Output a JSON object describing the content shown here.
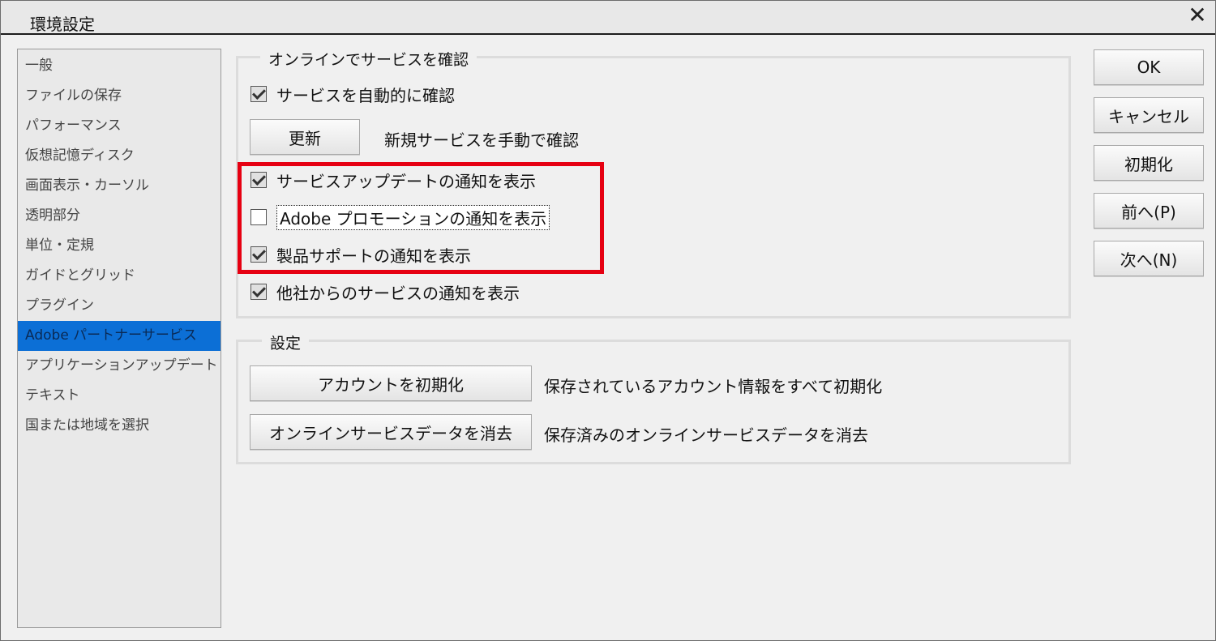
{
  "window": {
    "title": "環境設定"
  },
  "sidebar": {
    "items": [
      {
        "label": "一般"
      },
      {
        "label": "ファイルの保存"
      },
      {
        "label": "パフォーマンス"
      },
      {
        "label": "仮想記憶ディスク"
      },
      {
        "label": "画面表示・カーソル"
      },
      {
        "label": "透明部分"
      },
      {
        "label": "単位・定規"
      },
      {
        "label": "ガイドとグリッド"
      },
      {
        "label": "プラグイン"
      },
      {
        "label": "Adobe パートナーサービス",
        "selected": true
      },
      {
        "label": "アプリケーションアップデート"
      },
      {
        "label": "テキスト"
      },
      {
        "label": "国または地域を選択"
      }
    ]
  },
  "online_group": {
    "legend": "オンラインでサービスを確認",
    "auto_check": {
      "label": "サービスを自動的に確認",
      "checked": true
    },
    "update_button": "更新",
    "update_desc": "新規サービスを手動で確認",
    "service_update_notice": {
      "label": "サービスアップデートの通知を表示",
      "checked": true
    },
    "promo_notice": {
      "label": "Adobe プロモーションの通知を表示",
      "checked": false
    },
    "support_notice": {
      "label": "製品サポートの通知を表示",
      "checked": true
    },
    "third_party_notice": {
      "label": "他社からのサービスの通知を表示",
      "checked": true
    }
  },
  "settings_group": {
    "legend": "設定",
    "reset_account_button": "アカウントを初期化",
    "reset_account_desc": "保存されているアカウント情報をすべて初期化",
    "clear_data_button": "オンラインサービスデータを消去",
    "clear_data_desc": "保存済みのオンラインサービスデータを消去"
  },
  "side_buttons": {
    "ok": "OK",
    "cancel": "キャンセル",
    "reset": "初期化",
    "prev": "前へ(P)",
    "next": "次へ(N)"
  },
  "colors": {
    "highlight": "#e60012",
    "selection": "#0c6fd6"
  }
}
